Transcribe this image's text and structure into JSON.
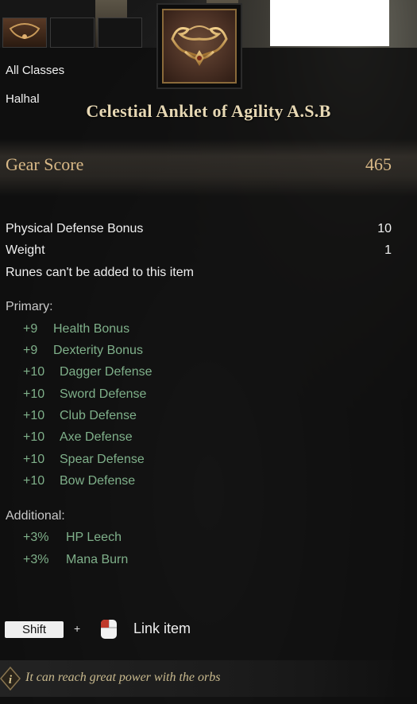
{
  "item": {
    "class_restriction": "All Classes",
    "region": "Halhal",
    "name": "Celestial Anklet of Agility A.S.B",
    "icon": "anklet-icon"
  },
  "gear_score": {
    "label": "Gear Score",
    "value": "465"
  },
  "stats": [
    {
      "label": "Physical Defense Bonus",
      "value": "10"
    },
    {
      "label": "Weight",
      "value": "1"
    }
  ],
  "runes_note": "Runes can't be added to this item",
  "primary": {
    "label": "Primary:",
    "bonuses": [
      {
        "value": "+9",
        "name": "Health Bonus"
      },
      {
        "value": "+9",
        "name": "Dexterity Bonus"
      },
      {
        "value": "+10",
        "name": "Dagger Defense"
      },
      {
        "value": "+10",
        "name": "Sword Defense"
      },
      {
        "value": "+10",
        "name": "Club Defense"
      },
      {
        "value": "+10",
        "name": "Axe Defense"
      },
      {
        "value": "+10",
        "name": "Spear Defense"
      },
      {
        "value": "+10",
        "name": "Bow Defense"
      }
    ]
  },
  "additional": {
    "label": "Additional:",
    "bonuses": [
      {
        "value": "+3%",
        "name": "HP Leech"
      },
      {
        "value": "+3%",
        "name": "Mana Burn"
      }
    ]
  },
  "footer": {
    "shift_key": "Shift",
    "plus": "+",
    "mouse_icon": "mouse-click-icon",
    "link_label": "Link item",
    "hint_icon": "info-icon",
    "hint_text": "It can reach great power with the orbs"
  },
  "colors": {
    "title": "#e7d8b4",
    "gear_score": "#d9b987",
    "bonus": "#7fb08a",
    "hint": "#c8b98d"
  }
}
